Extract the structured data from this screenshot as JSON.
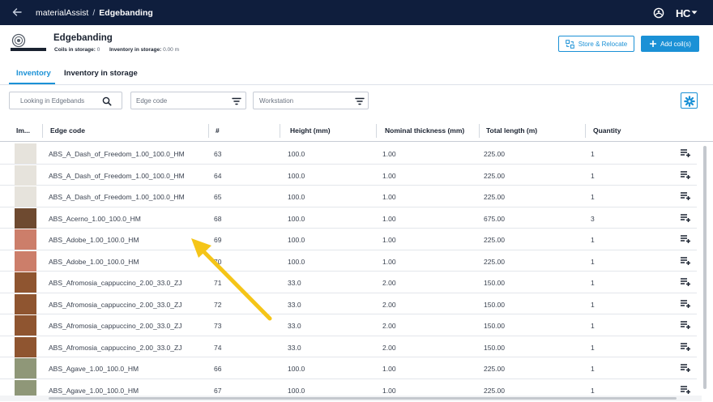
{
  "topbar": {
    "app": "materialAssist",
    "separator": "/",
    "current": "Edgebanding",
    "logo": "HC"
  },
  "header": {
    "title": "Edgebanding",
    "coils_label": "Coils in storage:",
    "coils_value": "0",
    "inventory_label": "Inventory in storage:",
    "inventory_value": "0.00 m",
    "store_button": "Store & Relocate",
    "add_button": "Add coil(s)"
  },
  "tabs": [
    {
      "label": "Inventory",
      "active": true
    },
    {
      "label": "Inventory in storage",
      "active": false
    }
  ],
  "filters": {
    "search_placeholder": "Looking in Edgebands",
    "edge_code_placeholder": "Edge code",
    "workstation_placeholder": "Workstation"
  },
  "table": {
    "columns": [
      "Im...",
      "Edge code",
      "#",
      "Height (mm)",
      "Nominal thickness (mm)",
      "Total length (m)",
      "Quantity"
    ],
    "rows": [
      {
        "swatch": "#e6e3dc",
        "code": "ABS_A_Dash_of_Freedom_1.00_100.0_HM",
        "num": "63",
        "height": "100.0",
        "thickness": "1.00",
        "length": "225.00",
        "qty": "1"
      },
      {
        "swatch": "#e6e3dc",
        "code": "ABS_A_Dash_of_Freedom_1.00_100.0_HM",
        "num": "64",
        "height": "100.0",
        "thickness": "1.00",
        "length": "225.00",
        "qty": "1"
      },
      {
        "swatch": "#e6e3dc",
        "code": "ABS_A_Dash_of_Freedom_1.00_100.0_HM",
        "num": "65",
        "height": "100.0",
        "thickness": "1.00",
        "length": "225.00",
        "qty": "1"
      },
      {
        "swatch": "#6e4a30",
        "code": "ABS_Acerno_1.00_100.0_HM",
        "num": "68",
        "height": "100.0",
        "thickness": "1.00",
        "length": "675.00",
        "qty": "3"
      },
      {
        "swatch": "#cc7e6a",
        "code": "ABS_Adobe_1.00_100.0_HM",
        "num": "69",
        "height": "100.0",
        "thickness": "1.00",
        "length": "225.00",
        "qty": "1"
      },
      {
        "swatch": "#cc7e6a",
        "code": "ABS_Adobe_1.00_100.0_HM",
        "num": "70",
        "height": "100.0",
        "thickness": "1.00",
        "length": "225.00",
        "qty": "1"
      },
      {
        "swatch": "#8f5530",
        "code": "ABS_Afromosia_cappuccino_2.00_33.0_ZJ",
        "num": "71",
        "height": "33.0",
        "thickness": "2.00",
        "length": "150.00",
        "qty": "1"
      },
      {
        "swatch": "#8f5530",
        "code": "ABS_Afromosia_cappuccino_2.00_33.0_ZJ",
        "num": "72",
        "height": "33.0",
        "thickness": "2.00",
        "length": "150.00",
        "qty": "1"
      },
      {
        "swatch": "#8f5530",
        "code": "ABS_Afromosia_cappuccino_2.00_33.0_ZJ",
        "num": "73",
        "height": "33.0",
        "thickness": "2.00",
        "length": "150.00",
        "qty": "1"
      },
      {
        "swatch": "#8f5530",
        "code": "ABS_Afromosia_cappuccino_2.00_33.0_ZJ",
        "num": "74",
        "height": "33.0",
        "thickness": "2.00",
        "length": "150.00",
        "qty": "1"
      },
      {
        "swatch": "#8f9778",
        "code": "ABS_Agave_1.00_100.0_HM",
        "num": "66",
        "height": "100.0",
        "thickness": "1.00",
        "length": "225.00",
        "qty": "1"
      },
      {
        "swatch": "#8f9778",
        "code": "ABS_Agave_1.00_100.0_HM",
        "num": "67",
        "height": "100.0",
        "thickness": "1.00",
        "length": "225.00",
        "qty": "1"
      }
    ]
  },
  "colors": {
    "topbar": "#0f1e3d",
    "accent": "#1b91d6",
    "arrow": "#f5c518"
  },
  "icons": {
    "back": "arrow-left-icon",
    "help": "help-icon",
    "store": "relocate-icon",
    "add": "plus-icon",
    "search": "search-icon",
    "filter": "filter-icon",
    "settings": "gear-icon",
    "row_action": "playlist-add-icon"
  }
}
